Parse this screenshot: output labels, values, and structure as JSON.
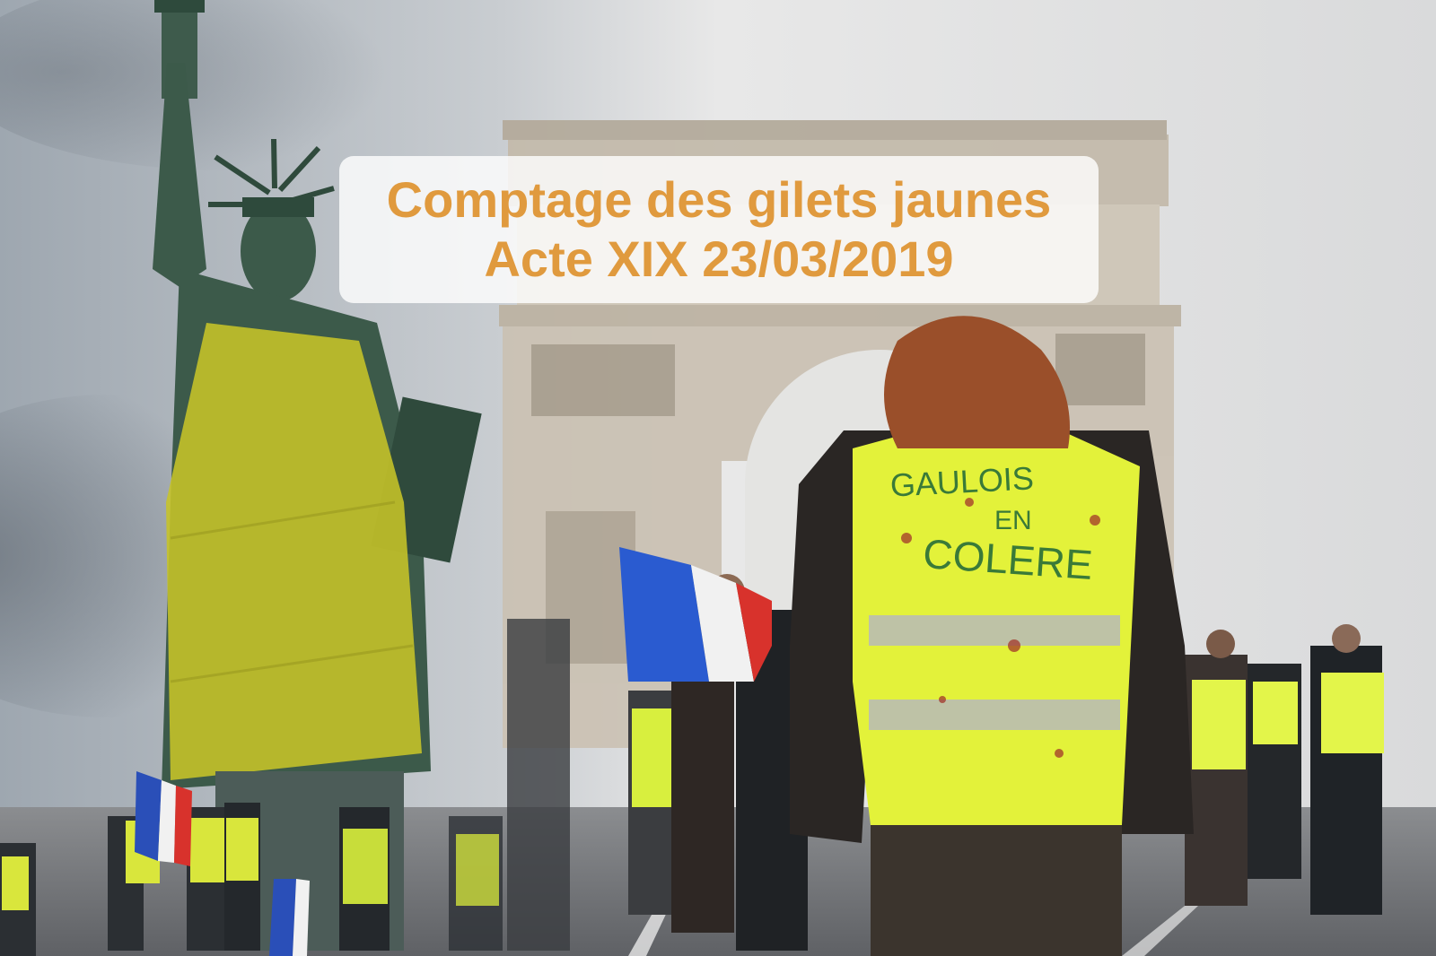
{
  "title": {
    "line1": "Comptage des gilets jaunes",
    "line2": "Acte XIX 23/03/2019"
  },
  "vest_text": [
    "GAULOIS",
    "EN",
    "COLERE"
  ],
  "colors": {
    "title_text": "#e09a3e",
    "card_background": "#ffffff",
    "vest_yellow": "#e6f542",
    "statue_green": "#3c5a4a",
    "arch_stone": "#cbc2b4",
    "flag_blue": "#2a5bd0",
    "flag_red": "#d8322c"
  }
}
